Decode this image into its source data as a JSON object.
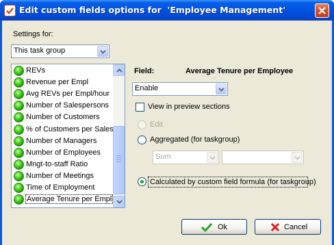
{
  "window": {
    "title": "Edit custom fields options for  'Employee Management'",
    "title_icon": "checkmark-app-icon",
    "close_icon": "close-icon"
  },
  "settings": {
    "label": "Settings for:",
    "selected": "This task group"
  },
  "field_list": {
    "items": [
      "REVs",
      "Revenue per Empl",
      "Avg REVs per Empl/hour",
      "Number of Salespersons",
      "Number of Customers",
      "% of Customers per Salesp",
      "Number of Managers",
      "Number of Employees",
      "Mngt-to-staff Ratio",
      "Number of Meetings",
      "Time of Employment",
      "Average Tenure per Empl"
    ],
    "selected_index": 11
  },
  "field": {
    "label": "Field:",
    "name": "Average Tenure per Employee",
    "mode": "Enable"
  },
  "options": {
    "view_in_preview": "View in preview sections",
    "edit": "Edit",
    "aggregated": "Aggregated (for taskgroup)",
    "aggregate_function": "Sum",
    "aggregate_field": "",
    "calculated": "Calculated by custom field formula (for taskgroup)"
  },
  "buttons": {
    "ok": "Ok",
    "cancel": "Cancel"
  },
  "colors": {
    "titlebar": "#0054e3",
    "dialog_bg": "#ece9d8",
    "ok_check": "#2aa12a",
    "cancel_x": "#d61f1f"
  }
}
